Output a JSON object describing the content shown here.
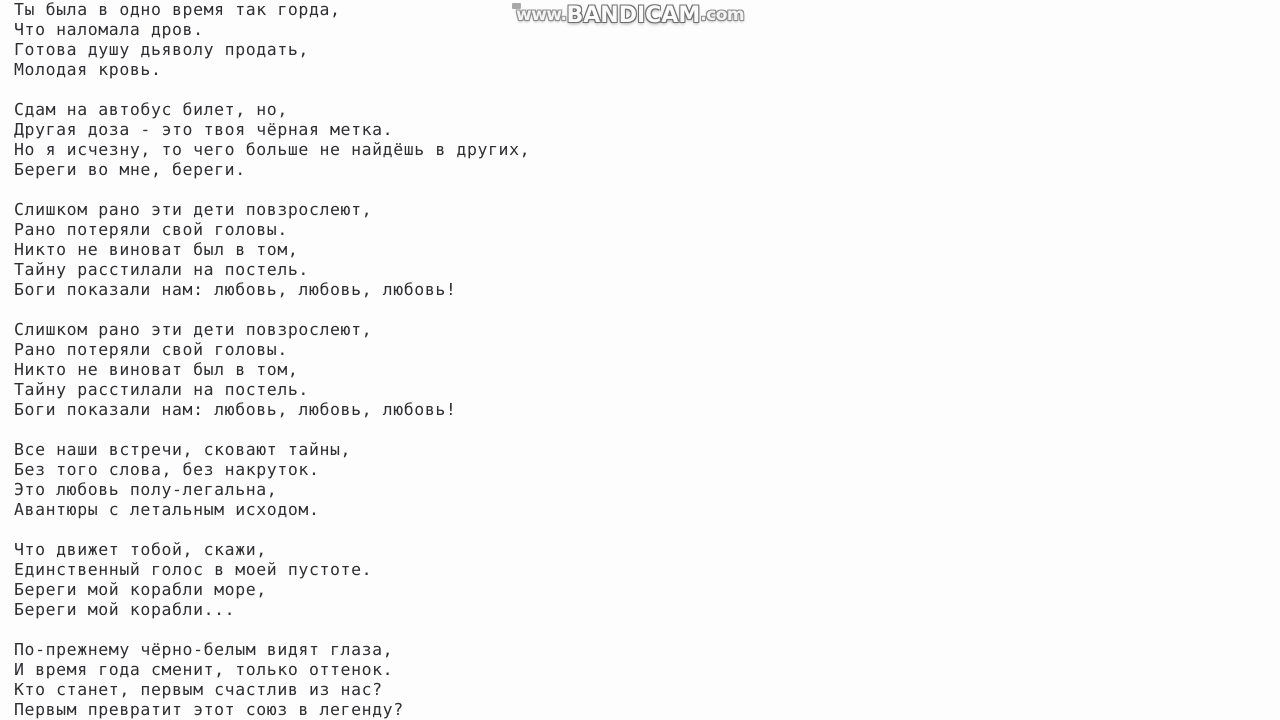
{
  "page": {
    "background_color": "#fdfdfd",
    "text_color": "#2f2f33",
    "kind": "song-lyrics-text-screen"
  },
  "watermark": {
    "name": "bandicam-watermark",
    "prefix": "www.",
    "brand": "BANDICAM",
    "suffix": ".com",
    "full_text": "www.BANDICAM.com",
    "color": "#f4f4f4",
    "outline_color": "#8e8e8e"
  },
  "lyrics": {
    "lines": [
      "Ты была в одно время так горда,",
      "Что наломала дров.",
      "Готова душу дьяволу продать,",
      "Молодая кровь.",
      "",
      "Сдам на автобус билет, но,",
      "Другая доза - это твоя чёрная метка.",
      "Но я исчезну, то чего больше не найдёшь в других,",
      "Береги во мне, береги.",
      "",
      "Слишком рано эти дети повзрослеют,",
      "Рано потеряли свой головы.",
      "Никто не виноват был в том,",
      "Тайну расстилали на постель.",
      "Боги показали нам: любовь, любовь, любовь!",
      "",
      "Слишком рано эти дети повзрослеют,",
      "Рано потеряли свой головы.",
      "Никто не виноват был в том,",
      "Тайну расстилали на постель.",
      "Боги показали нам: любовь, любовь, любовь!",
      "",
      "Все наши встречи, сковают тайны,",
      "Без того слова, без накруток.",
      "Это любовь полу-легальна,",
      "Авантюры с летальным исходом.",
      "",
      "Что движет тобой, скажи,",
      "Единственный голос в моей пустоте.",
      "Береги мой корабли море,",
      "Береги мой корабли...",
      "",
      "По-прежнему чёрно-белым видят глаза,",
      "И время года сменит, только оттенок.",
      "Кто станет, первым счастлив из нас?",
      "Первым превратит этот союз в легенду?"
    ]
  }
}
